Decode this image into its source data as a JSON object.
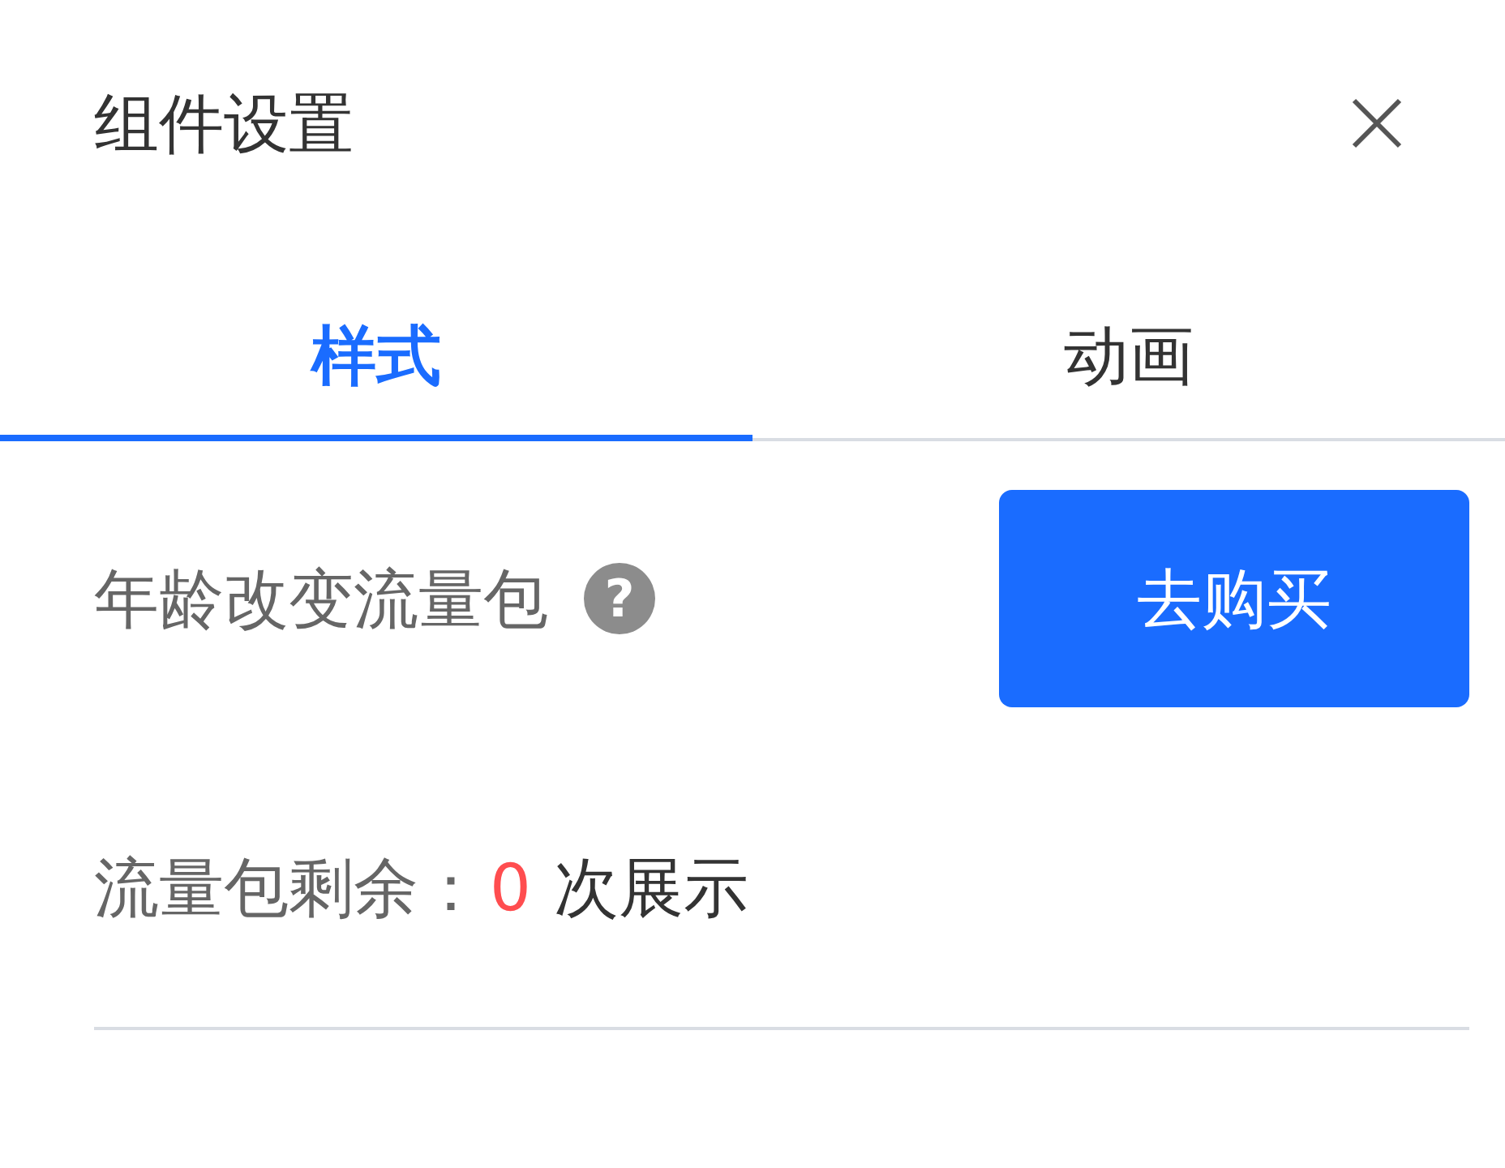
{
  "panel": {
    "title": "组件设置"
  },
  "tabs": [
    {
      "label": "样式",
      "selected": true
    },
    {
      "label": "动画",
      "selected": false
    }
  ],
  "traffic_pack": {
    "label": "年龄改变流量包",
    "help": "?",
    "button": "去购买"
  },
  "remaining": {
    "label": "流量包剩余：",
    "count": "0",
    "unit": "次展示"
  }
}
